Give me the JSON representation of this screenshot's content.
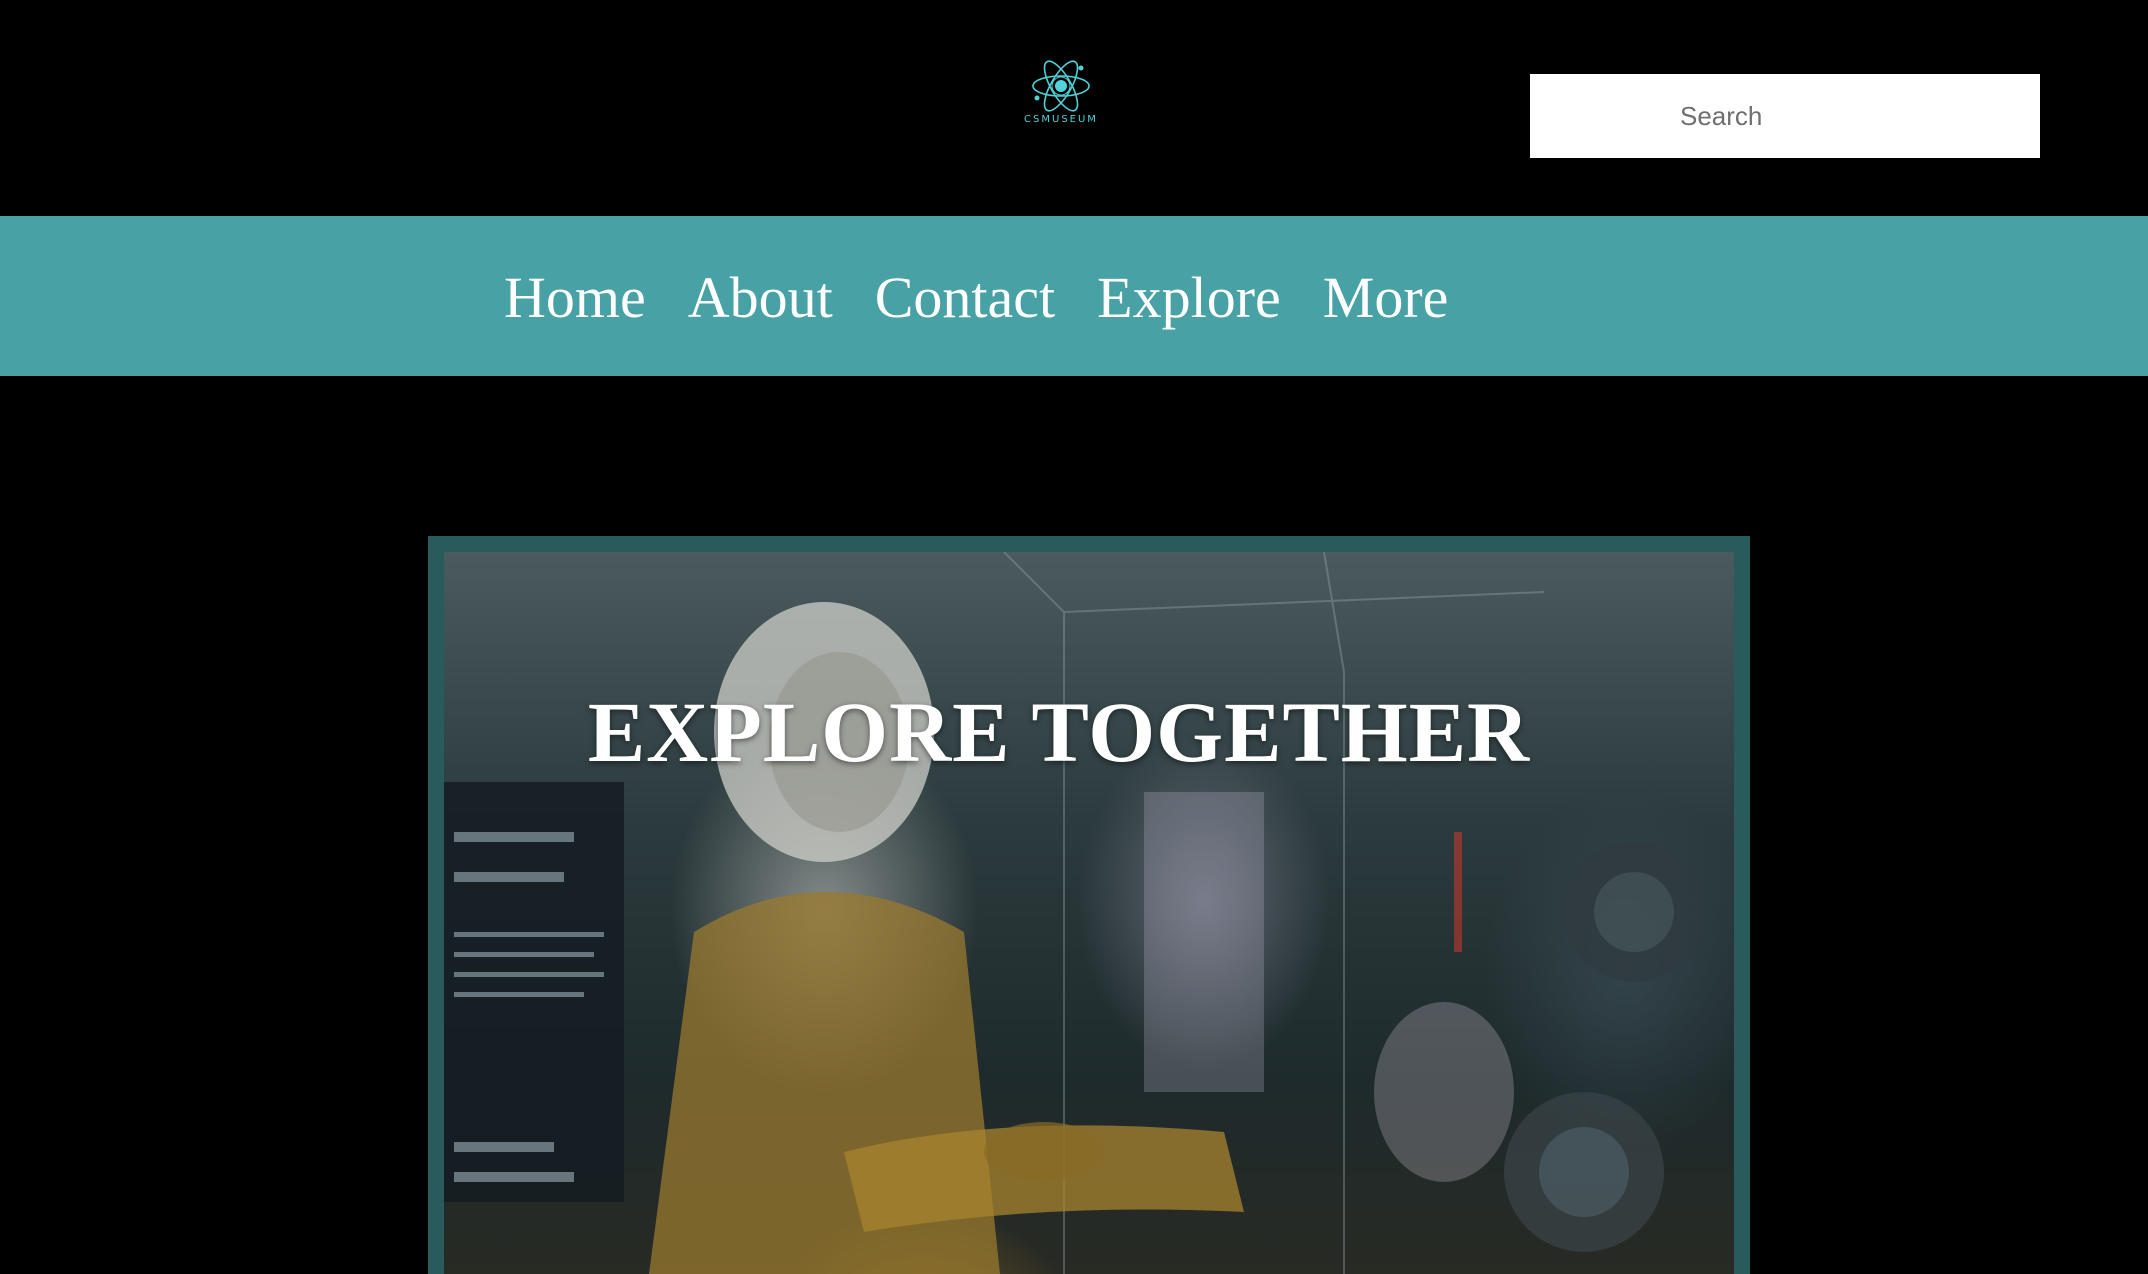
{
  "header": {
    "logo_text": "CSMUSEUM",
    "search": {
      "placeholder": "Search",
      "value": ""
    }
  },
  "nav": {
    "items": [
      {
        "label": "Home"
      },
      {
        "label": "About"
      },
      {
        "label": "Contact"
      },
      {
        "label": "Explore"
      },
      {
        "label": "More"
      }
    ]
  },
  "hero": {
    "title": "EXPLORE TOGETHER",
    "image_icon": "astronaut-exhibit-image"
  },
  "colors": {
    "background": "#000000",
    "nav_bar": "#48a1a5",
    "hero_frame": "#2a5b5c",
    "logo_accent": "#4fd2d8"
  }
}
